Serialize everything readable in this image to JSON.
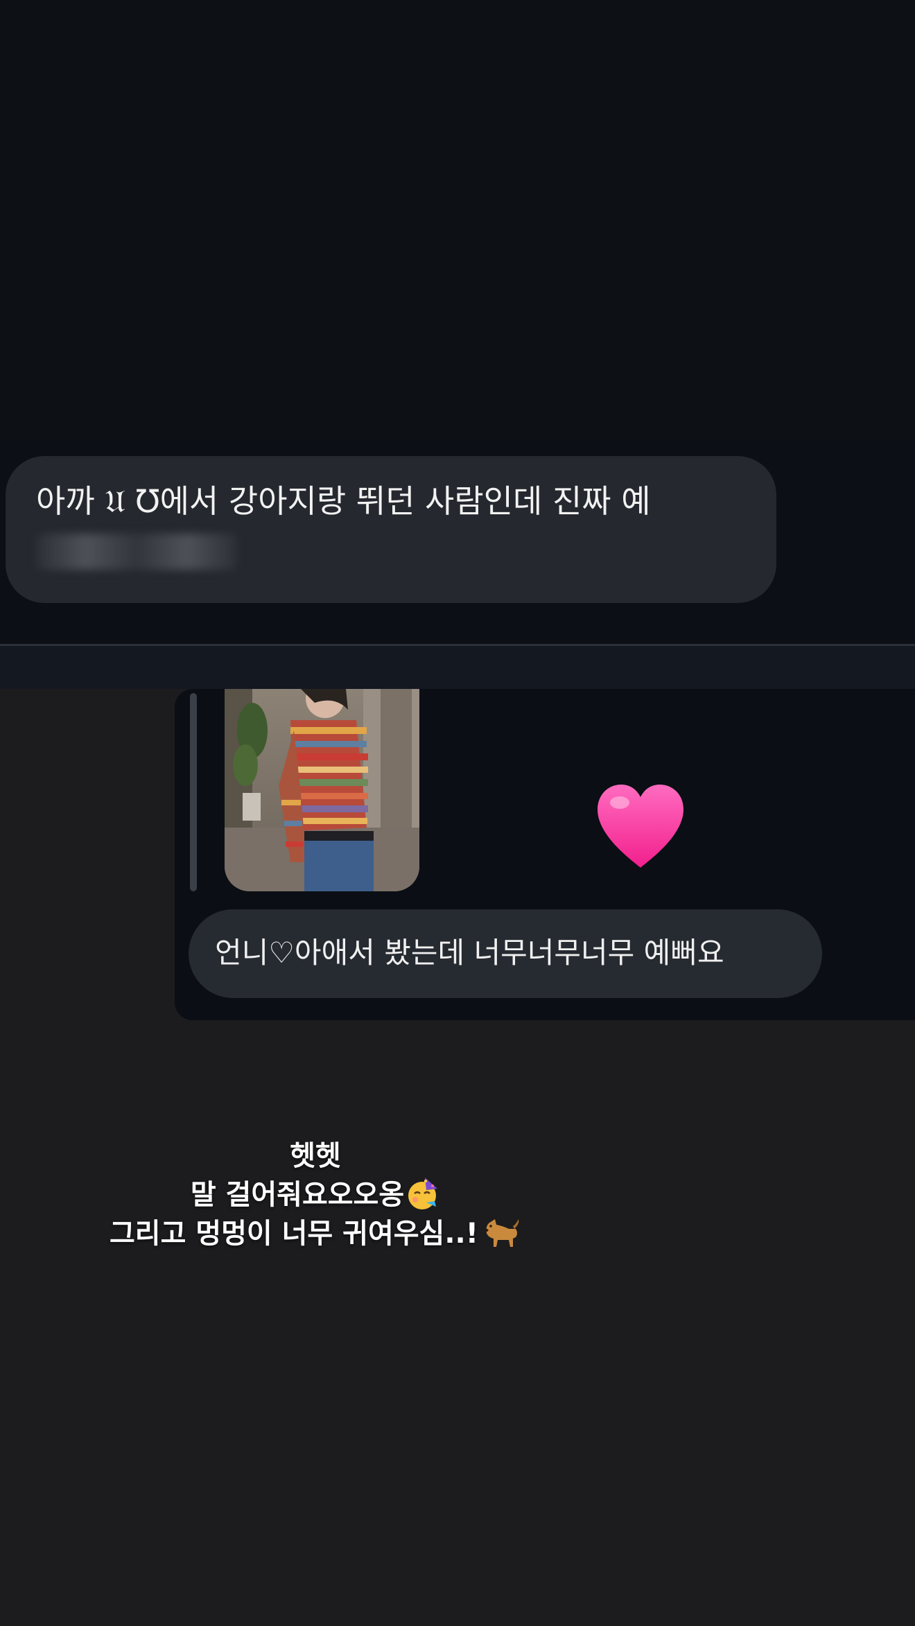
{
  "message_1": {
    "text": "아까 𝔘 ℧에서 강아지랑 뛰던 사람인데 진짜 예"
  },
  "reply": {
    "reaction": "heart",
    "message_text": "언니♡아애서 봤는데 너무너무너무 예뻐요"
  },
  "caption": {
    "line_1": "헷헷",
    "line_2": "말 걸어줘요오오옹",
    "line_3": "그리고 멍멍이 너무 귀여우심..!"
  },
  "icons": {
    "heart": "heart-icon",
    "party_face": "partying-face-emoji",
    "dog": "dog-emoji"
  },
  "colors": {
    "heart": "#ff3fa5",
    "bubble": "#25282e",
    "background_top": "#0d1015",
    "background_bottom": "#1c1c1e"
  }
}
